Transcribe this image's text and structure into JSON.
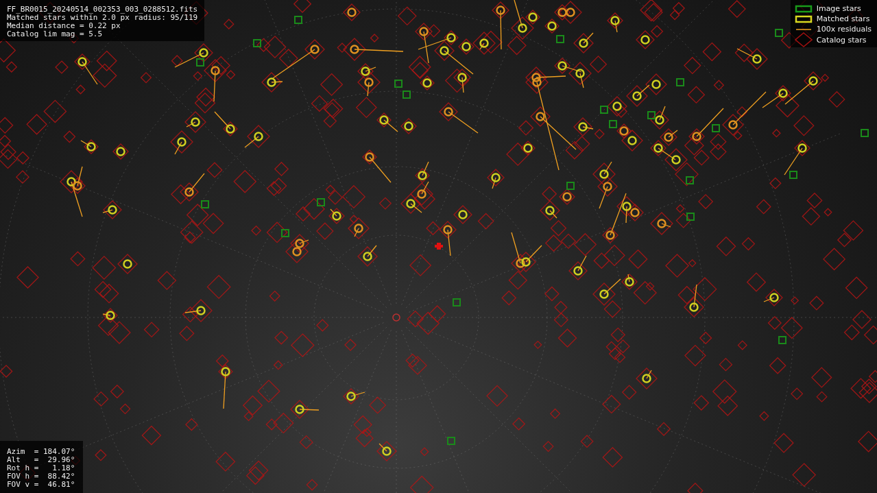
{
  "file_info": {
    "lines": [
      "FF_BR0015_20240514_002353_003_0288512.fits",
      "Matched stars within 2.0 px radius: 95/119",
      "Median distance = 0.22 px",
      "Catalog lim mag = 5.5"
    ]
  },
  "legend": [
    {
      "kind": "image",
      "label": "Image stars"
    },
    {
      "kind": "matched",
      "label": "Matched stars"
    },
    {
      "kind": "residual",
      "label": "100x residuals"
    },
    {
      "kind": "catalog",
      "label": "Catalog stars"
    }
  ],
  "pointing": {
    "lines": [
      "Azim  = 184.07°",
      "Alt   =  29.96°",
      "Rot h =   1.18°",
      "FOV h =  88.42°",
      "FOV v =  46.81°"
    ]
  }
}
